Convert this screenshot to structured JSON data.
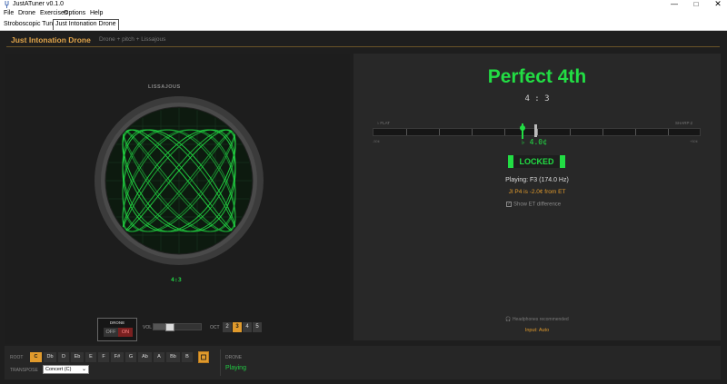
{
  "window": {
    "title": "JustATuner v0.1.0",
    "minimize_glyph": "—",
    "maximize_glyph": "□",
    "close_glyph": "✕"
  },
  "menu": [
    "File",
    "Drone",
    "Exercises",
    "Options",
    "Help"
  ],
  "tabs": [
    {
      "label": "Stroboscopic Tuner",
      "active": false
    },
    {
      "label": "Just Intonation Drone",
      "active": true
    }
  ],
  "header": {
    "title": "Just Intonation Drone",
    "subtitle": "Drone + pitch + Lissajous"
  },
  "lissajous": {
    "label": "LISSAJOUS",
    "ratio": "4:3"
  },
  "drone_toggle": {
    "label": "DRONE",
    "off": "OFF",
    "on": "ON",
    "state": "on"
  },
  "volume": {
    "label": "VOL",
    "level": 0.3
  },
  "octave": {
    "label": "OCT",
    "options": [
      "2",
      "3",
      "4",
      "5"
    ],
    "selected": "3"
  },
  "tuner": {
    "interval_name": "Perfect 4th",
    "ratio": "4 : 3",
    "flat_label": "♭ FLAT",
    "sharp_label": "SHARP ♯",
    "range_min": "-50¢",
    "range_max": "+50¢",
    "cents_readout": "♭ 4.0¢",
    "cents_value": -4.0,
    "locked_text": "LOCKED",
    "playing": "Playing: F3  (174.0 Hz)",
    "ji_diff": "JI P4 is -2.0¢ from ET",
    "show_et_label": "Show ET difference",
    "show_et_checked": true,
    "headphones": "🎧 Headphones recommended",
    "input": "Input: Auto"
  },
  "root": {
    "label": "ROOT",
    "notes": [
      "C",
      "Db",
      "D",
      "Eb",
      "E",
      "F",
      "F#",
      "G",
      "Ab",
      "A",
      "Bb",
      "B"
    ],
    "selected": "C"
  },
  "transpose": {
    "label": "TRANSPOSE",
    "value": "Concert (C)"
  },
  "drone_status": {
    "label": "DRONE",
    "value": "Playing"
  },
  "colors": {
    "accent": "#e09a2c",
    "green": "#22dd44",
    "background": "#1e1e1e"
  }
}
